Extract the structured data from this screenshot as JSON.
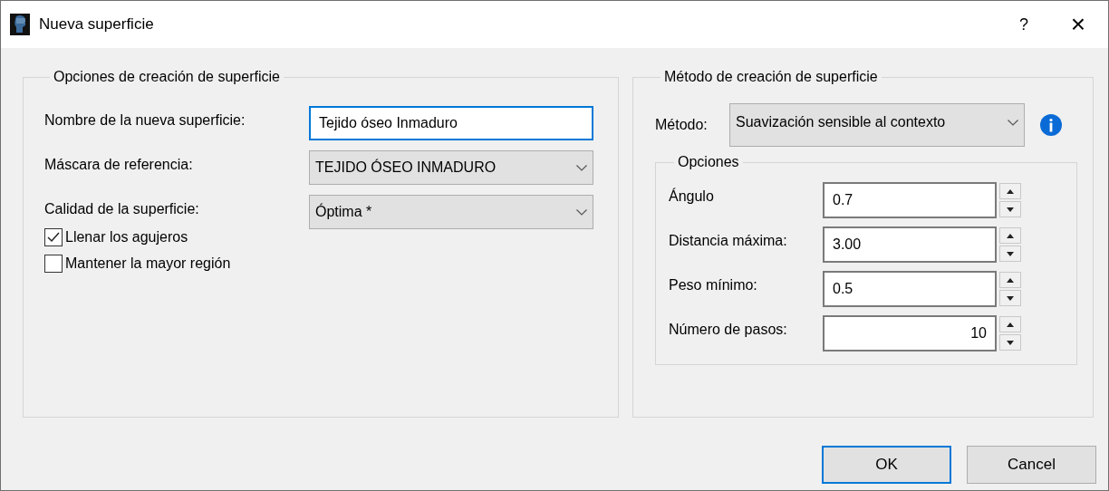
{
  "window": {
    "title": "Nueva superficie",
    "help": "?",
    "close": "×"
  },
  "creation_options": {
    "title": "Opciones de creación de superficie",
    "name_field": {
      "label": "Nombre de la nueva superficie:",
      "value": "Tejido óseo Inmaduro",
      "focused": true
    },
    "mask": {
      "label": "Máscara de referencia:",
      "value": "TEJIDO ÓSEO INMADURO"
    },
    "quality": {
      "label": "Calidad de la superficie:",
      "value": "Óptima *"
    },
    "checkboxes": [
      {
        "label": "Llenar los agujeros",
        "checked": true
      },
      {
        "label": "Mantener la mayor región",
        "checked": false
      }
    ]
  },
  "method_panel": {
    "title": "Método de creación de superficie",
    "method": {
      "label": "Método:",
      "value": "Suavización sensible al contexto"
    },
    "options": {
      "title": "Opciones",
      "fields": [
        {
          "label": "Ángulo",
          "value": "0.7",
          "kind": "decimal"
        },
        {
          "label": "Distancia máxima:",
          "value": "3.00",
          "kind": "decimal"
        },
        {
          "label": "Peso mínimo:",
          "value": "0.5",
          "kind": "decimal"
        },
        {
          "label": "Número de pasos:",
          "value": "10",
          "kind": "integer"
        }
      ]
    }
  },
  "buttons": [
    {
      "label": "OK",
      "default": true
    },
    {
      "label": "Cancel",
      "default": false
    }
  ]
}
